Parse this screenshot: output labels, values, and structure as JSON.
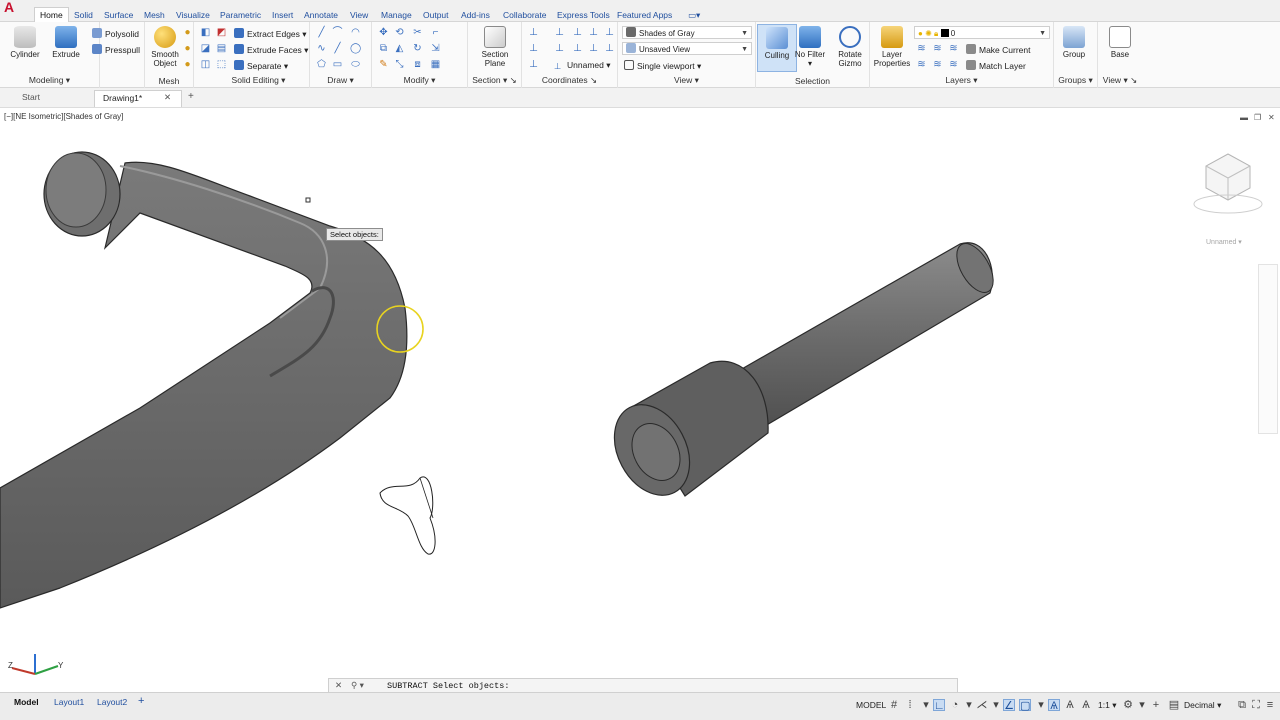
{
  "app": {
    "logo": "A"
  },
  "menu": {
    "tabs": [
      "Home",
      "Solid",
      "Surface",
      "Mesh",
      "Visualize",
      "Parametric",
      "Insert",
      "Annotate",
      "View",
      "Manage",
      "Output",
      "Add-ins",
      "Collaborate",
      "Express Tools",
      "Featured Apps"
    ],
    "active": "Home"
  },
  "ribbon": {
    "modeling": {
      "title": "Modeling",
      "cylinder": "Cylinder",
      "extrude": "Extrude",
      "polysolid": "Polysolid",
      "presspull": "Presspull"
    },
    "mesh": {
      "title": "Mesh",
      "smooth_object_1": "Smooth",
      "smooth_object_2": "Object"
    },
    "solid_editing": {
      "title": "Solid Editing",
      "extract_edges": "Extract Edges",
      "extrude_faces": "Extrude Faces",
      "separate": "Separate"
    },
    "draw": {
      "title": "Draw"
    },
    "modify": {
      "title": "Modify"
    },
    "section": {
      "title": "Section",
      "section_plane_1": "Section",
      "section_plane_2": "Plane"
    },
    "coordinates": {
      "title": "Coordinates",
      "ucs_named": "Unnamed"
    },
    "view": {
      "title": "View",
      "visual_style": "Shades of Gray",
      "saved_view": "Unsaved View",
      "viewport_config": "Single viewport"
    },
    "selection": {
      "title": "Selection",
      "culling": "Culling",
      "no_filter_1": "No Filter",
      "rotate_gizmo_1": "Rotate",
      "rotate_gizmo_2": "Gizmo"
    },
    "layers": {
      "title": "Layers",
      "layer_properties_1": "Layer",
      "layer_properties_2": "Properties",
      "current_layer": "0",
      "make_current": "Make Current",
      "match_layer": "Match Layer"
    },
    "groups": {
      "title": "Groups",
      "group": "Group"
    },
    "view2": {
      "title": "View",
      "base": "Base"
    }
  },
  "file_tabs": {
    "start": "Start",
    "drawing": "Drawing1*",
    "close": "✕",
    "new": "+"
  },
  "viewport": {
    "label": "[−][NE Isometric][Shades of Gray]",
    "tooltip": "Select objects:",
    "viewcube_ucs": "Unnamed",
    "axis_z": "Z",
    "axis_y": "Y"
  },
  "command_line": {
    "close": "✕",
    "text": "SUBTRACT Select objects:"
  },
  "status": {
    "layout_tabs": [
      "Model",
      "Layout1",
      "Layout2"
    ],
    "active_layout": "Model",
    "add_layout": "+",
    "model_space": "MODEL",
    "scale": "1:1",
    "units": "Decimal"
  }
}
